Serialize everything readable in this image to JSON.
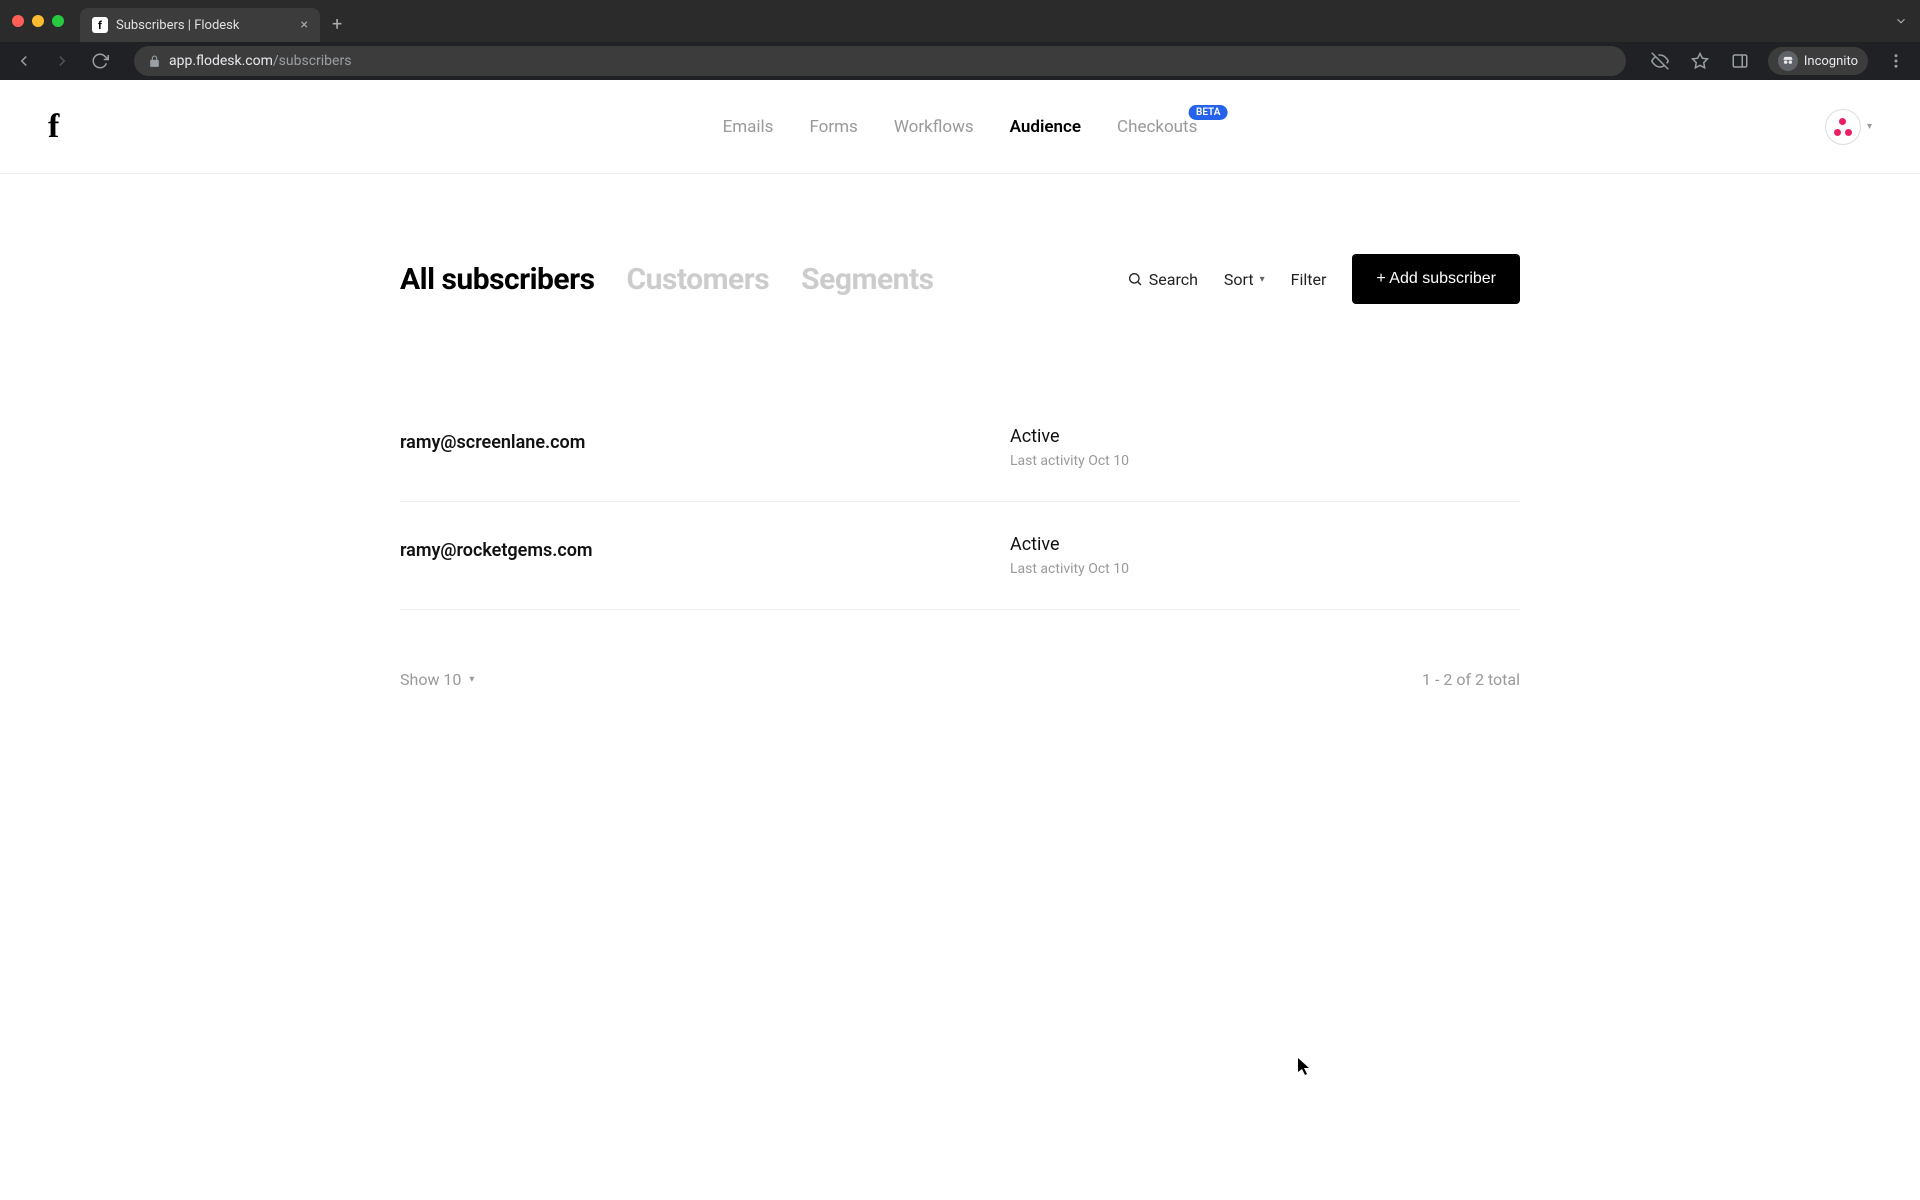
{
  "browser": {
    "tab_title": "Subscribers | Flodesk",
    "url_domain": "app.flodesk.com",
    "url_path": "/subscribers",
    "incognito_label": "Incognito"
  },
  "nav": {
    "items": [
      {
        "label": "Emails",
        "active": false
      },
      {
        "label": "Forms",
        "active": false
      },
      {
        "label": "Workflows",
        "active": false
      },
      {
        "label": "Audience",
        "active": true
      },
      {
        "label": "Checkouts",
        "active": false,
        "badge": "BETA"
      }
    ]
  },
  "view": {
    "tabs": [
      {
        "label": "All subscribers",
        "active": true
      },
      {
        "label": "Customers",
        "active": false
      },
      {
        "label": "Segments",
        "active": false
      }
    ],
    "actions": {
      "search": "Search",
      "sort": "Sort",
      "filter": "Filter",
      "add": "+ Add subscriber"
    }
  },
  "subscribers": [
    {
      "email": "ramy@screenlane.com",
      "status": "Active",
      "activity": "Last activity Oct 10"
    },
    {
      "email": "ramy@rocketgems.com",
      "status": "Active",
      "activity": "Last activity Oct 10"
    }
  ],
  "pagination": {
    "page_size_label": "Show 10",
    "range_label": "1 - 2 of 2 total"
  }
}
